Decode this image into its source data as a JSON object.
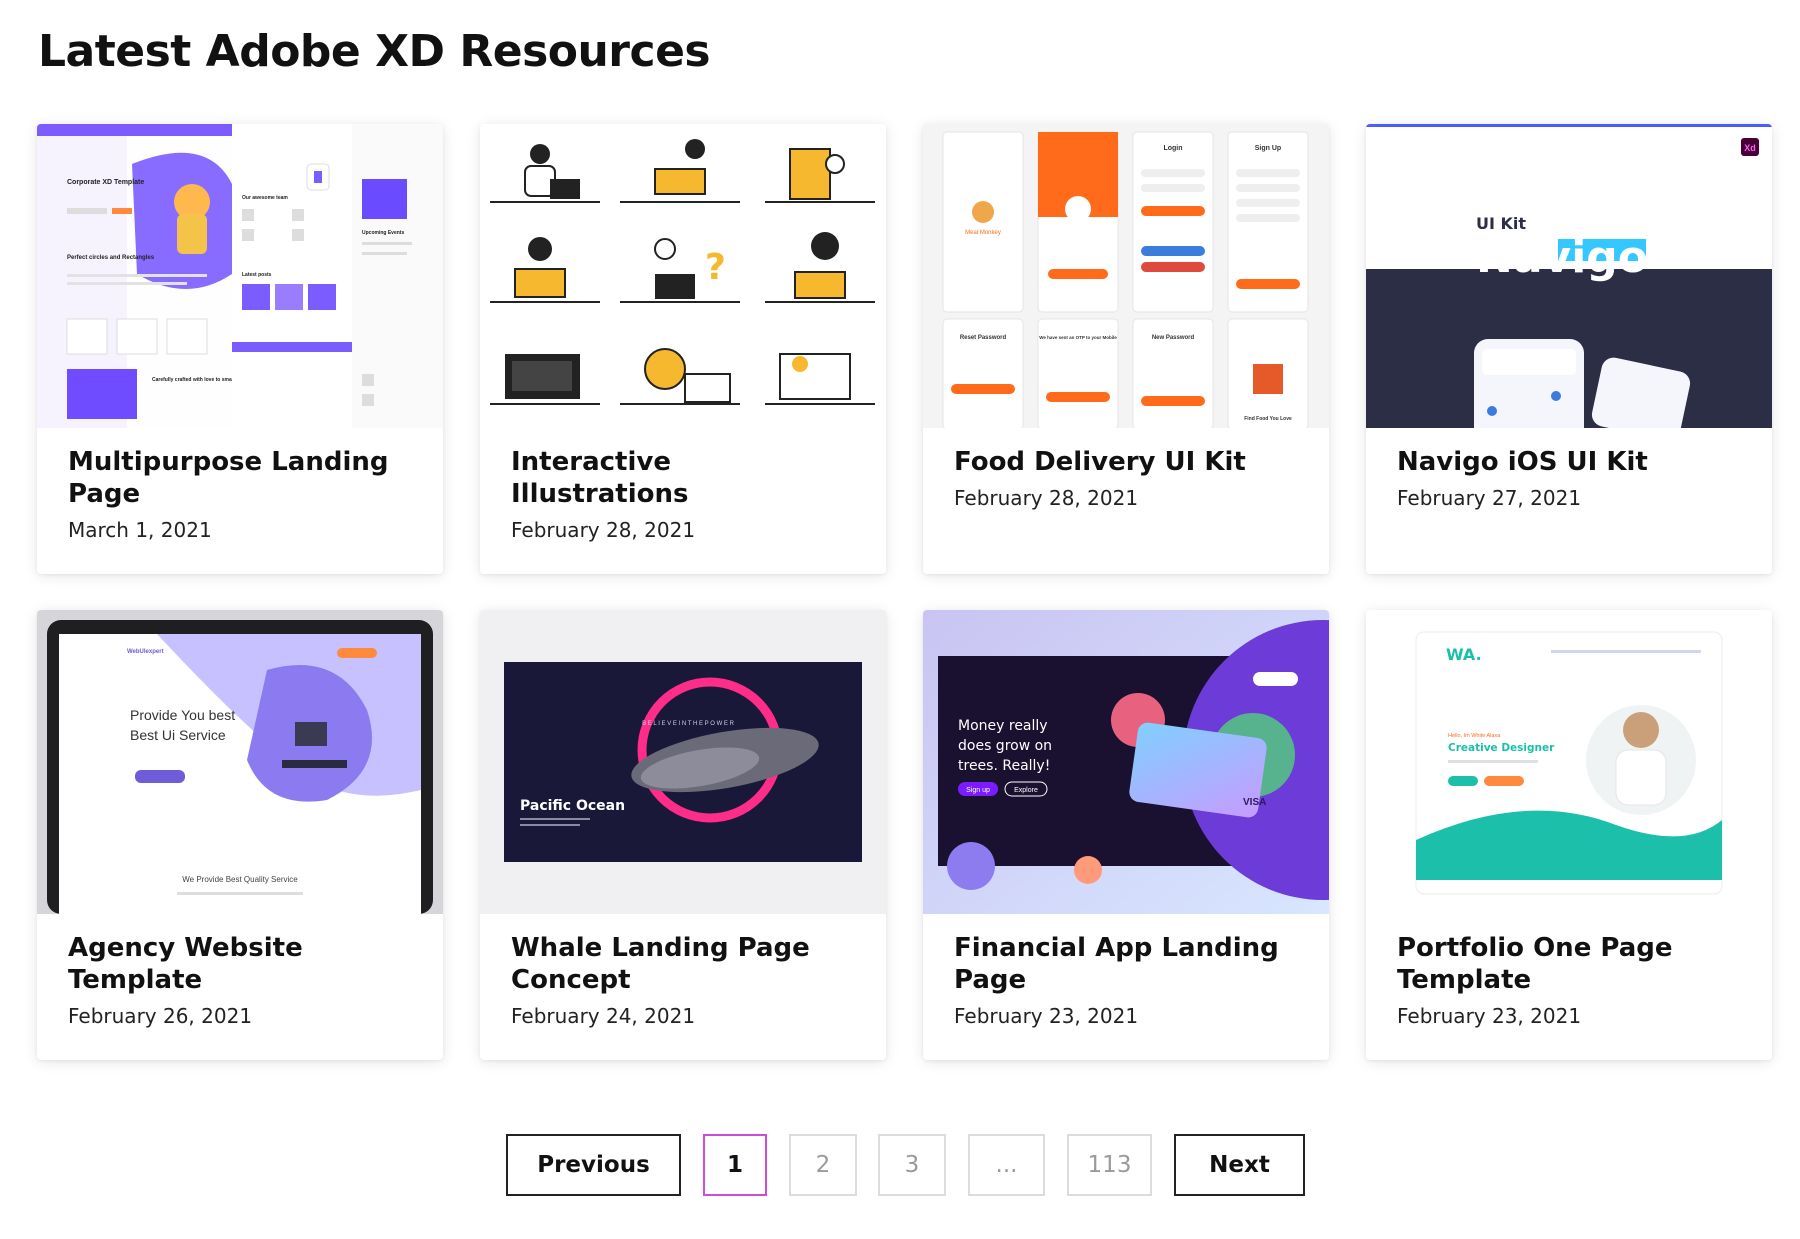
{
  "page": {
    "title": "Latest Adobe XD Resources"
  },
  "cards": [
    {
      "title": "Multipurpose Landing Page",
      "date": "March 1, 2021",
      "thumb": {
        "heading": "Corporate XD Template",
        "sub": "Perfect circles and Rectangles",
        "section": "Our awesome team",
        "section2": "Latest posts",
        "section3": "Carefully crafted with love to small things",
        "events": "Upcoming Events"
      }
    },
    {
      "title": "Interactive Illustrations",
      "date": "February 28, 2021",
      "thumb": {}
    },
    {
      "title": "Food Delivery UI Kit",
      "date": "February 28, 2021",
      "thumb": {
        "brand": "Meal Monkey",
        "login": "Login",
        "signup": "Sign Up",
        "reset": "Reset Password",
        "otp": "We have sent an OTP to your Mobile",
        "newpass": "New Password",
        "find": "Find Food You Love"
      }
    },
    {
      "title": "Navigo iOS UI Kit",
      "date": "February 27, 2021",
      "thumb": {
        "kit": "UI Kit",
        "name": "Navigo",
        "badge": "Xd"
      }
    },
    {
      "title": "Agency Website Template",
      "date": "February 26, 2021",
      "thumb": {
        "brand": "WebUIexpert",
        "line1": "Provide You best",
        "line2": "Best Ui Service",
        "service": "We Provide Best Quality Service"
      }
    },
    {
      "title": "Whale Landing Page Concept",
      "date": "February 24, 2021",
      "thumb": {
        "tagline": "B E L I E V E   I N   T H E   P O W E R",
        "name": "Pacific Ocean"
      }
    },
    {
      "title": "Financial App Landing Page",
      "date": "February 23, 2021",
      "thumb": {
        "line1": "Money really",
        "line2": "does grow on",
        "line3": "trees. Really!",
        "btn1": "Sign up",
        "btn2": "Explore",
        "card": "VISA"
      }
    },
    {
      "title": "Portfolio One Page Template",
      "date": "February 23, 2021",
      "thumb": {
        "logo": "WA.",
        "hello": "Hello, Im White Alaxa",
        "role": "Creative Designer"
      }
    }
  ],
  "pagination": {
    "previous": "Previous",
    "next": "Next",
    "pages": [
      "1",
      "2",
      "3",
      "...",
      "113"
    ],
    "current": "1"
  },
  "colors": {
    "accent_purple": "#7b5cff",
    "accent_orange": "#ff6b1a",
    "active_page_border": "#d04ae0",
    "teal": "#1bbfaa"
  }
}
